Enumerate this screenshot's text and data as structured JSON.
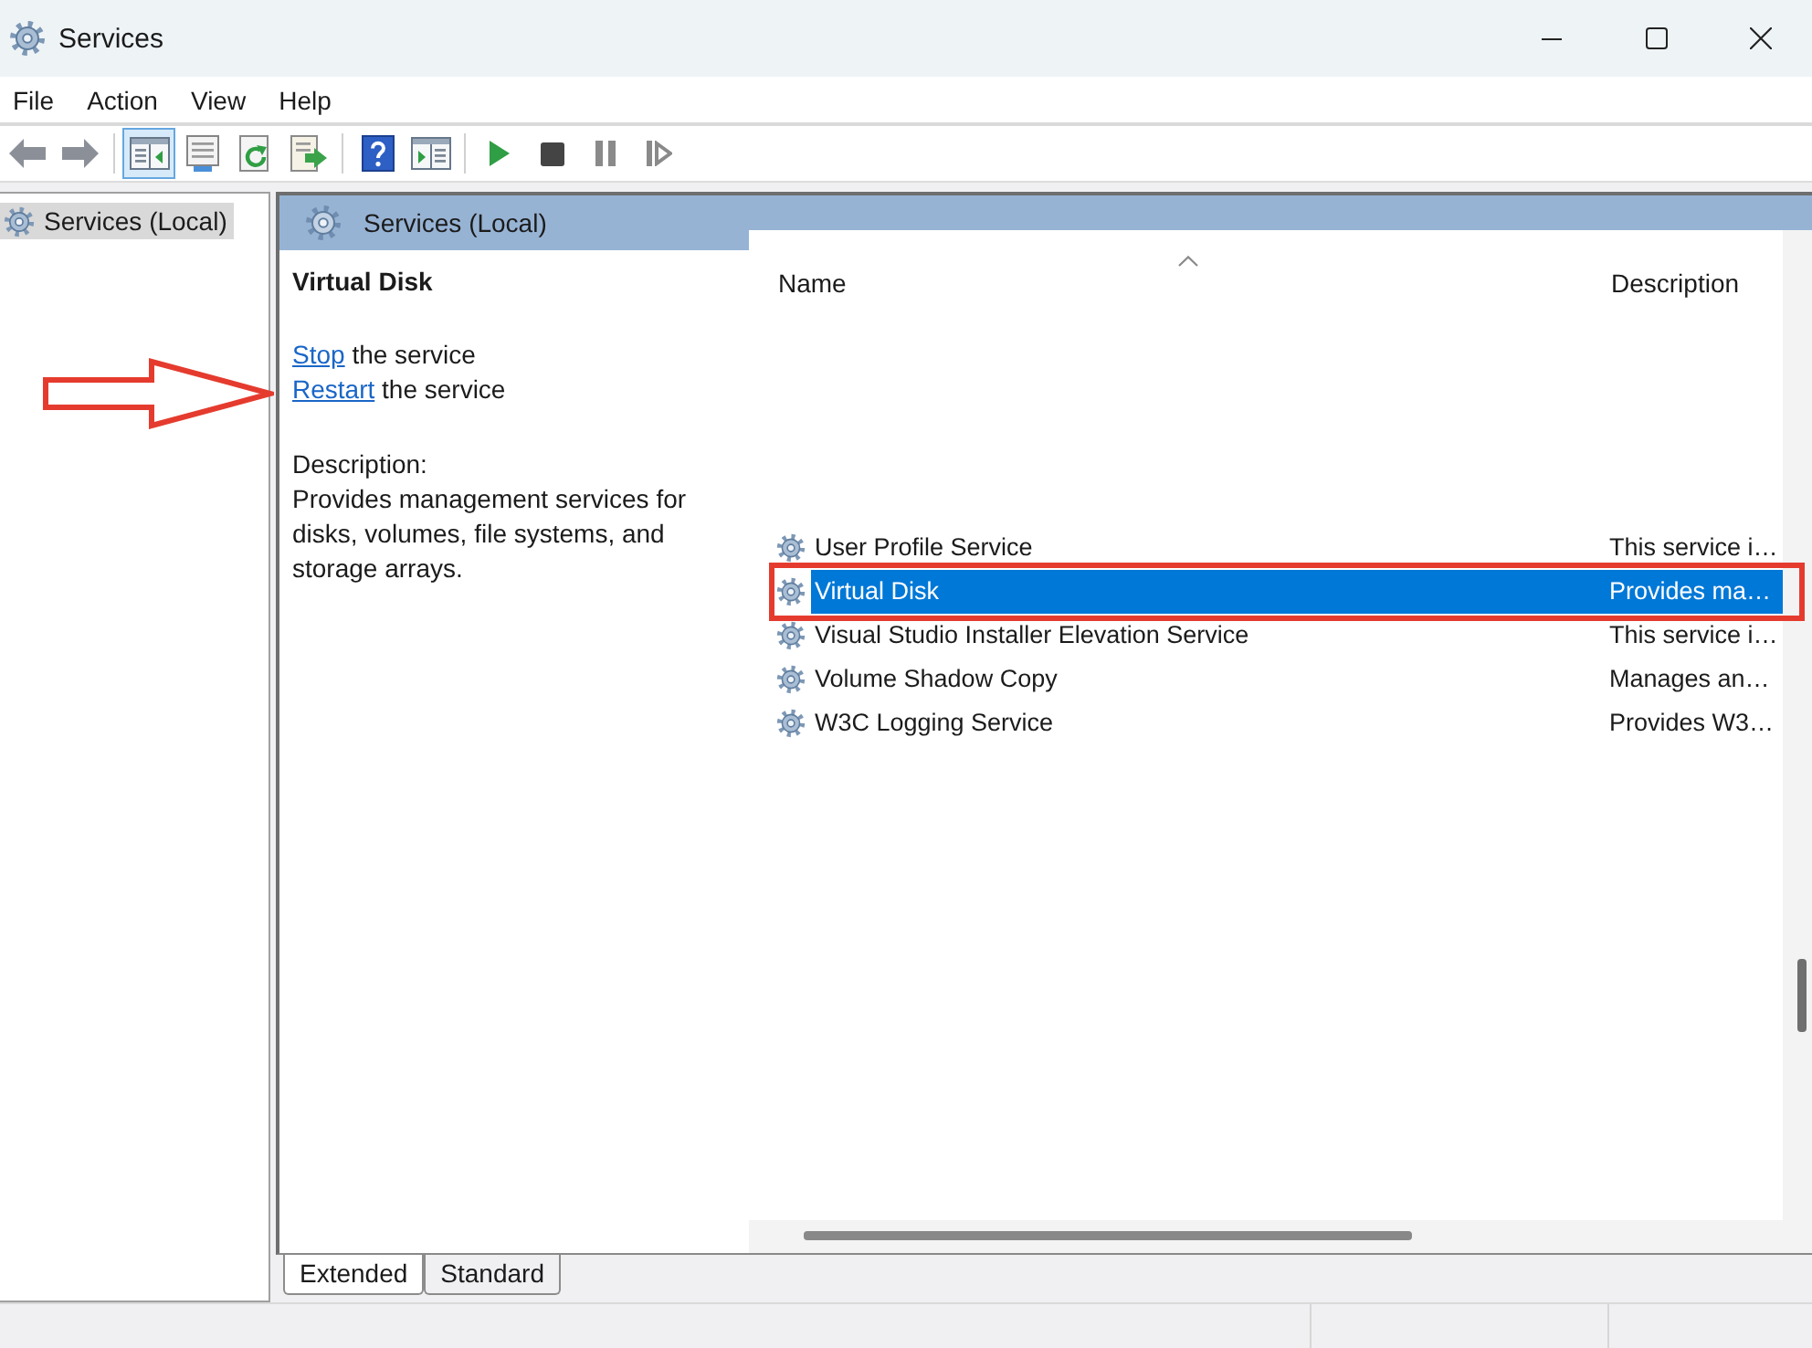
{
  "window": {
    "title": "Services"
  },
  "menu": [
    "File",
    "Action",
    "View",
    "Help"
  ],
  "toolbar": [
    {
      "items": [
        {
          "kind": "back",
          "pressed": false
        },
        {
          "kind": "forward",
          "pressed": false
        }
      ]
    },
    {
      "items": [
        {
          "kind": "console_tree",
          "pressed": true
        },
        {
          "kind": "properties",
          "pressed": false
        },
        {
          "kind": "refresh",
          "pressed": false
        },
        {
          "kind": "export",
          "pressed": false
        }
      ]
    },
    {
      "items": [
        {
          "kind": "help",
          "pressed": false
        },
        {
          "kind": "action_pane",
          "pressed": false
        }
      ]
    },
    {
      "items": [
        {
          "kind": "start",
          "pressed": false
        },
        {
          "kind": "stop",
          "pressed": false
        },
        {
          "kind": "pause",
          "pressed": false
        },
        {
          "kind": "restart",
          "pressed": false
        }
      ]
    }
  ],
  "tree": {
    "items": [
      {
        "label": "Services (Local)",
        "selected": true
      }
    ]
  },
  "pane": {
    "title": "Services (Local)",
    "details": {
      "name": "Virtual Disk",
      "actions": [
        {
          "link": "Stop",
          "text": "the service"
        },
        {
          "link": "Restart",
          "text": "the service"
        }
      ],
      "description_label": "Description:",
      "description": "Provides management services for disks, volumes, file systems, and storage arrays."
    },
    "table": {
      "columns": [
        {
          "label": "Name",
          "sorted": true
        },
        {
          "label": "Description",
          "sorted": false
        }
      ],
      "rows": [
        {
          "name": "User Profile Service",
          "description": "This service i…",
          "selected": false
        },
        {
          "name": "Virtual Disk",
          "description": "Provides ma…",
          "selected": true
        },
        {
          "name": "Visual Studio Installer Elevation Service",
          "description": "This service i…",
          "selected": false
        },
        {
          "name": "Volume Shadow Copy",
          "description": "Manages an…",
          "selected": false
        },
        {
          "name": "W3C Logging Service",
          "description": "Provides W3…",
          "selected": false
        }
      ]
    },
    "view_tabs": [
      {
        "label": "Extended",
        "selected": true
      },
      {
        "label": "Standard",
        "selected": false
      }
    ]
  }
}
